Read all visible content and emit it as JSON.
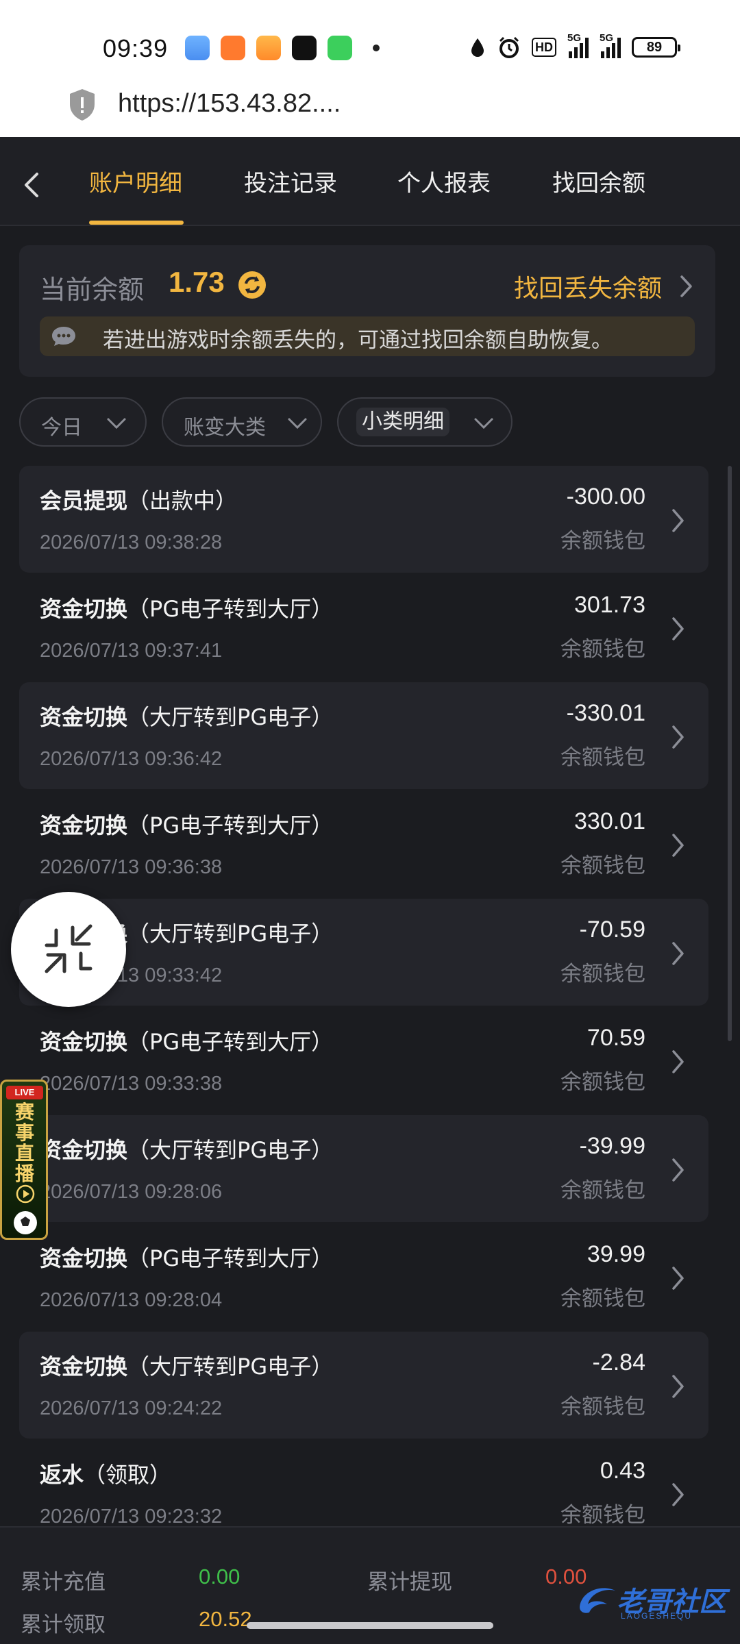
{
  "status_bar": {
    "time": "09:39",
    "hd_label": "HD",
    "signal_1_label": "5G",
    "signal_2_label": "5G",
    "battery": "89",
    "icons": [
      "weather-app-icon",
      "orange-app-icon",
      "video-app-icon",
      "music-app-icon",
      "phone-app-icon",
      "drop-icon",
      "alarm-icon"
    ]
  },
  "browser": {
    "url": "https://153.43.82...."
  },
  "tabs": [
    {
      "label": "账户明细",
      "active": true
    },
    {
      "label": "投注记录",
      "active": false
    },
    {
      "label": "个人报表",
      "active": false
    },
    {
      "label": "找回余额",
      "active": false
    }
  ],
  "balance": {
    "label": "当前余额",
    "value": "1.73",
    "recover_label": "找回丢失余额",
    "notice": "若进出游戏时余额丢失的，可通过找回余额自助恢复。"
  },
  "filters": [
    {
      "label": "今日"
    },
    {
      "label": "账变大类"
    },
    {
      "label": "小类明细"
    }
  ],
  "transactions": [
    {
      "title": "会员提现",
      "detail": "（出款中）",
      "date": "2026/07/13 09:38:28",
      "amount": "-300.00",
      "wallet": "余额钱包"
    },
    {
      "title": "资金切换",
      "detail": "（PG电子转到大厅）",
      "date": "2026/07/13 09:37:41",
      "amount": "301.73",
      "wallet": "余额钱包"
    },
    {
      "title": "资金切换",
      "detail": "（大厅转到PG电子）",
      "date": "2026/07/13 09:36:42",
      "amount": "-330.01",
      "wallet": "余额钱包"
    },
    {
      "title": "资金切换",
      "detail": "（PG电子转到大厅）",
      "date": "2026/07/13 09:36:38",
      "amount": "330.01",
      "wallet": "余额钱包"
    },
    {
      "title": "资金切换",
      "detail": "（大厅转到PG电子）",
      "date": "2026/07/13 09:33:42",
      "amount": "-70.59",
      "wallet": "余额钱包"
    },
    {
      "title": "资金切换",
      "detail": "（PG电子转到大厅）",
      "date": "2026/07/13 09:33:38",
      "amount": "70.59",
      "wallet": "余额钱包"
    },
    {
      "title": "资金切换",
      "detail": "（大厅转到PG电子）",
      "date": "2026/07/13 09:28:06",
      "amount": "-39.99",
      "wallet": "余额钱包"
    },
    {
      "title": "资金切换",
      "detail": "（PG电子转到大厅）",
      "date": "2026/07/13 09:28:04",
      "amount": "39.99",
      "wallet": "余额钱包"
    },
    {
      "title": "资金切换",
      "detail": "（大厅转到PG电子）",
      "date": "2026/07/13 09:24:22",
      "amount": "-2.84",
      "wallet": "余额钱包"
    },
    {
      "title": "返水",
      "detail": "（领取）",
      "date": "2026/07/13 09:23:32",
      "amount": "0.43",
      "wallet": "余额钱包"
    }
  ],
  "live_banner": {
    "tag": "LIVE",
    "text": "赛事直播"
  },
  "summary": {
    "total_deposit_label": "累计充值",
    "total_deposit": "0.00",
    "total_withdraw_label": "累计提现",
    "total_withdraw": "0.00",
    "total_claimed_label": "累计领取",
    "total_claimed": "20.52"
  },
  "watermark": {
    "text": "老哥社区",
    "sub": "LAOGESHEQU"
  },
  "colors": {
    "accent": "#f2b640",
    "positive": "#3fbf4a",
    "negative": "#e0513e",
    "background": "#1b1c20"
  }
}
